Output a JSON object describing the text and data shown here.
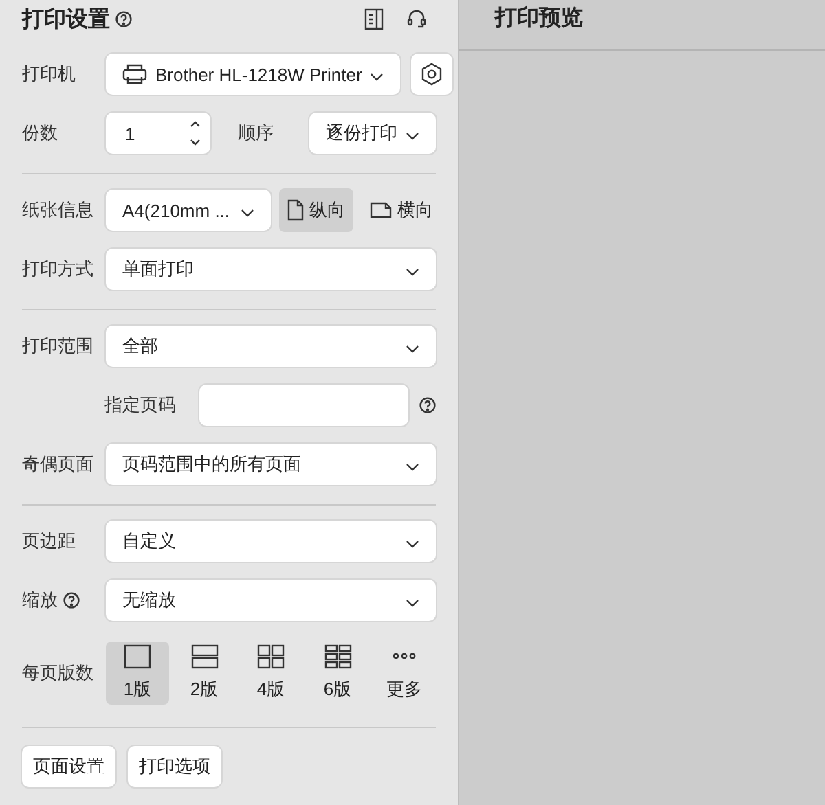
{
  "settings": {
    "title": "打印设置",
    "sections": [
      [
        {
          "kind": "printer",
          "label": "打印机",
          "value": "Brother HL-1218W Printer"
        },
        {
          "kind": "copies",
          "label": "份数",
          "value": "1",
          "order_label": "顺序",
          "order_value": "逐份打印"
        }
      ],
      [
        {
          "kind": "paper",
          "label": "纸张信息",
          "value": "A4(210mm ...",
          "orientations": [
            {
              "kind": "portrait",
              "label": "纵向",
              "selected": true
            },
            {
              "kind": "landscape",
              "label": "横向",
              "selected": false
            }
          ]
        },
        {
          "kind": "select",
          "label": "打印方式",
          "value": "单面打印"
        }
      ],
      [
        {
          "kind": "select",
          "label": "打印范围",
          "value": "全部"
        },
        {
          "kind": "input",
          "label": "指定页码"
        },
        {
          "kind": "select",
          "label": "奇偶页面",
          "value": "页码范围中的所有页面"
        }
      ],
      [
        {
          "kind": "select",
          "label": "页边距",
          "value": "自定义"
        },
        {
          "kind": "select",
          "label": "缩放",
          "help": true,
          "value": "无缩放"
        },
        {
          "kind": "layouts",
          "label": "每页版数",
          "options": [
            {
              "kind": "single",
              "label": "1版",
              "selected": true
            },
            {
              "kind": "double",
              "label": "2版",
              "selected": false
            },
            {
              "kind": "quad",
              "label": "4版",
              "selected": false
            },
            {
              "kind": "six",
              "label": "6版",
              "selected": false
            },
            {
              "kind": "more",
              "label": "更多",
              "selected": false
            }
          ]
        }
      ]
    ],
    "buttons": [
      "页面设置",
      "打印选项"
    ]
  },
  "preview": {
    "title": "打印预览"
  }
}
